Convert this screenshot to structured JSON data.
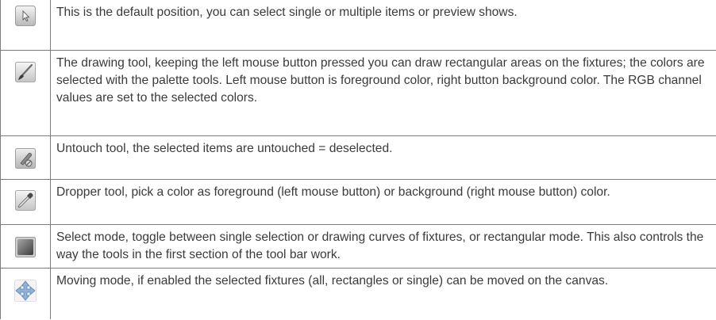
{
  "tools": [
    {
      "icon": "arrow-pointer-icon",
      "description": "This is the default position, you can select single or multiple items or preview shows."
    },
    {
      "icon": "brush-icon",
      "description": "The drawing tool, keeping the left mouse button pressed you can draw rectangular areas on the fixtures; the colors are selected with the palette tools. Left mouse button is foreground color, right button background color. The RGB channel values are set to the selected colors."
    },
    {
      "icon": "untouch-icon",
      "description": "Untouch tool, the selected items are untouched = deselected."
    },
    {
      "icon": "dropper-icon",
      "description": "Dropper tool, pick a color as foreground (left mouse button) or background (right mouse button) color."
    },
    {
      "icon": "select-mode-icon",
      "description": "Select mode, toggle between single selection or drawing curves of fixtures, or rectangular mode. This also controls the way the tools in the first section of the tool bar work."
    },
    {
      "icon": "move-arrows-icon",
      "description": "Moving mode, if enabled the selected fixtures (all, rectangles or single) can be moved on the canvas."
    }
  ]
}
